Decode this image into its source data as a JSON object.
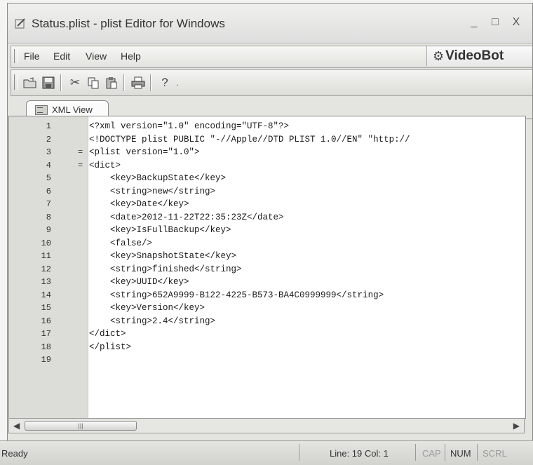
{
  "window": {
    "title": "Status.plist - plist Editor for Windows",
    "controls": {
      "minimize": "_",
      "maximize": "□",
      "close": "X"
    }
  },
  "menu": {
    "items": [
      "File",
      "Edit",
      "View",
      "Help"
    ],
    "logo_text": "VideoBot"
  },
  "toolbar": {
    "icons": [
      "open-folder-icon",
      "save-icon",
      "cut-icon",
      "copy-icon",
      "paste-icon",
      "print-icon",
      "help-icon"
    ]
  },
  "tabs": [
    {
      "label": "XML View",
      "active": true
    }
  ],
  "editor": {
    "lines": [
      {
        "num": "1",
        "fold": "",
        "code": "<?xml version=\"1.0\" encoding=\"UTF-8\"?>"
      },
      {
        "num": "2",
        "fold": "",
        "code": "<!DOCTYPE plist PUBLIC \"-//Apple//DTD PLIST 1.0//EN\" \"http://"
      },
      {
        "num": "3",
        "fold": "=",
        "code": "<plist version=\"1.0\">"
      },
      {
        "num": "4",
        "fold": "=",
        "code": "<dict>"
      },
      {
        "num": "5",
        "fold": "",
        "code": "    <key>BackupState</key>"
      },
      {
        "num": "6",
        "fold": "",
        "code": "    <string>new</string>"
      },
      {
        "num": "7",
        "fold": "",
        "code": "    <key>Date</key>"
      },
      {
        "num": "8",
        "fold": "",
        "code": "    <date>2012-11-22T22:35:23Z</date>"
      },
      {
        "num": "9",
        "fold": "",
        "code": "    <key>IsFullBackup</key>"
      },
      {
        "num": "10",
        "fold": "",
        "code": "    <false/>"
      },
      {
        "num": "11",
        "fold": "",
        "code": "    <key>SnapshotState</key>"
      },
      {
        "num": "12",
        "fold": "",
        "code": "    <string>finished</string>"
      },
      {
        "num": "13",
        "fold": "",
        "code": "    <key>UUID</key>"
      },
      {
        "num": "14",
        "fold": "",
        "code": "    <string>652A9999-B122-4225-B573-BA4C0999999</string>"
      },
      {
        "num": "15",
        "fold": "",
        "code": "    <key>Version</key>"
      },
      {
        "num": "16",
        "fold": "",
        "code": "    <string>2.4</string>"
      },
      {
        "num": "17",
        "fold": "",
        "code": "</dict>"
      },
      {
        "num": "18",
        "fold": "",
        "code": "</plist>"
      },
      {
        "num": "19",
        "fold": "",
        "code": ""
      }
    ]
  },
  "statusbar": {
    "ready": "Ready",
    "position": "Line: 19 Col: 1",
    "caps": "CAP",
    "num": "NUM",
    "scroll": "SCRL"
  }
}
